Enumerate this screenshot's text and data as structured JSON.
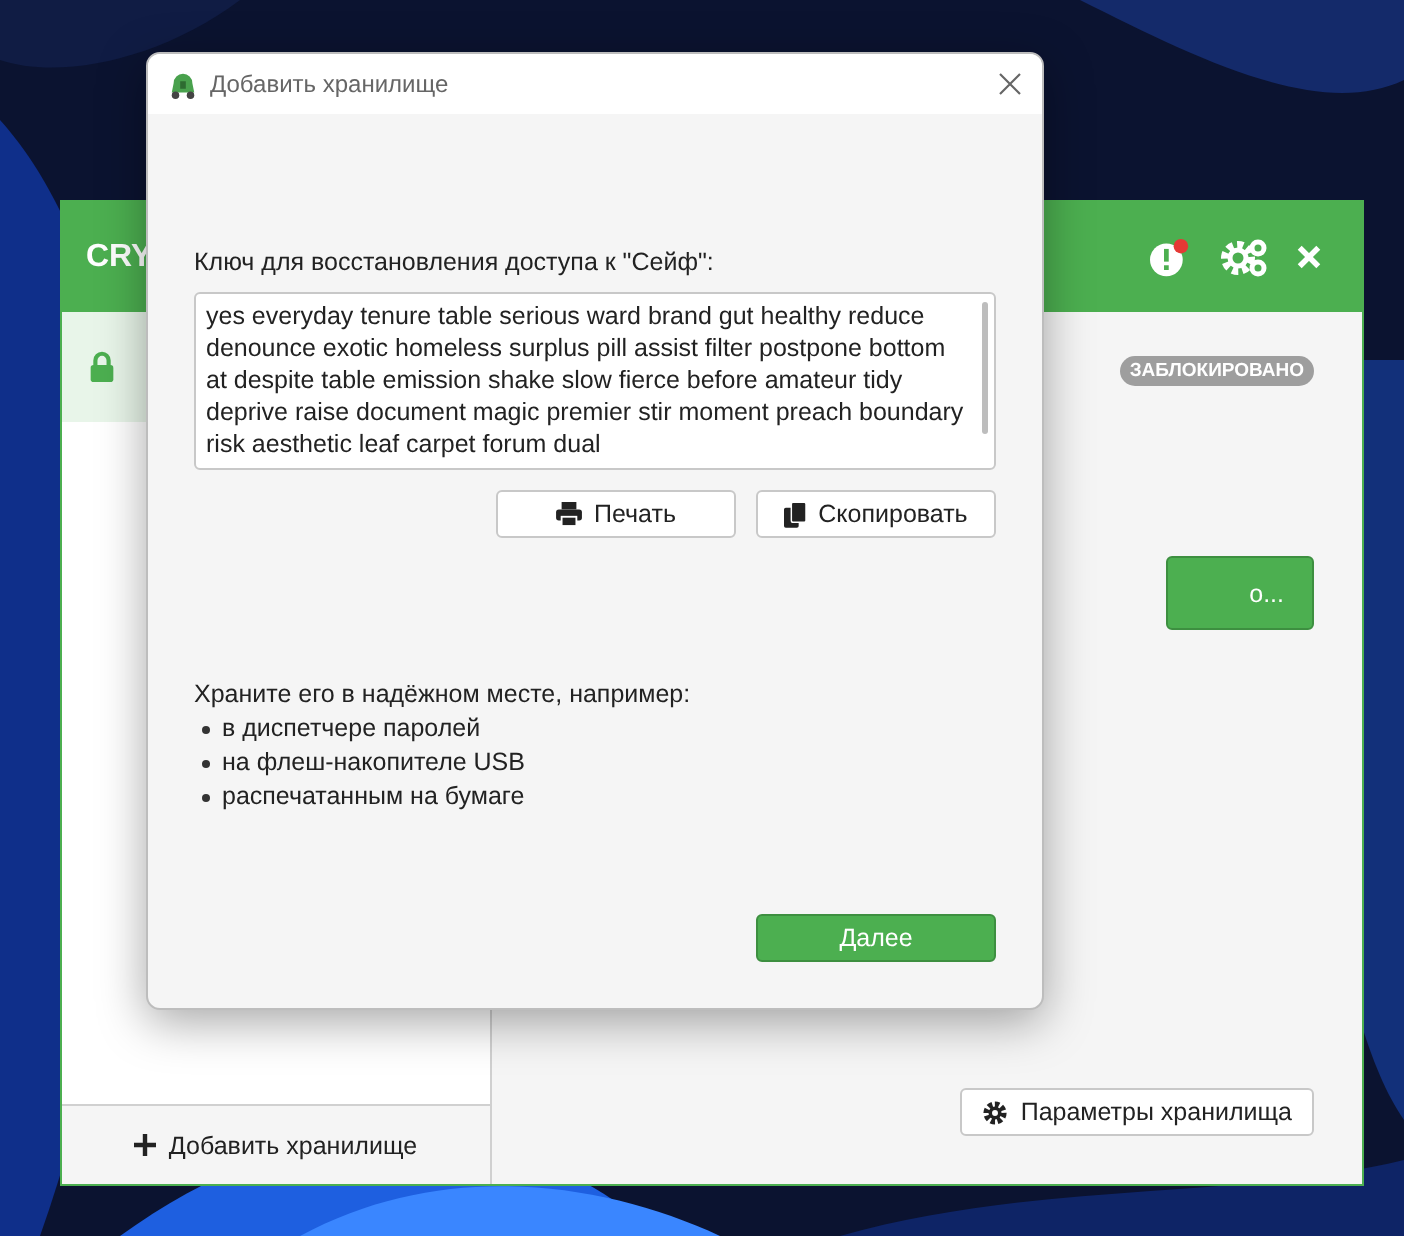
{
  "main_window": {
    "title": "CRY",
    "vaults": [
      {
        "selected": true
      }
    ],
    "status_badge": "ЗАБЛОКИРОВАНО",
    "unlock_button": "о...",
    "settings_button": "Параметры хранилища",
    "add_vault_button": "Добавить хранилище"
  },
  "dialog": {
    "title": "Добавить хранилище",
    "prompt": "Ключ для восстановления доступа к \"Сейф\":",
    "recovery_key": "yes everyday tenure table serious ward brand gut healthy reduce denounce exotic homeless surplus pill assist filter postpone bottom at despite table emission shake slow fierce before amateur tidy deprive raise document magic premier stir moment preach boundary risk aesthetic leaf carpet forum dual",
    "print_button": "Печать",
    "copy_button": "Скопировать",
    "advice": "Храните его в надёжном месте, например:",
    "advice_items": [
      "в диспетчере паролей",
      "на флеш-накопителе USB",
      "распечатанным на бумаге"
    ],
    "next_button": "Далее"
  }
}
